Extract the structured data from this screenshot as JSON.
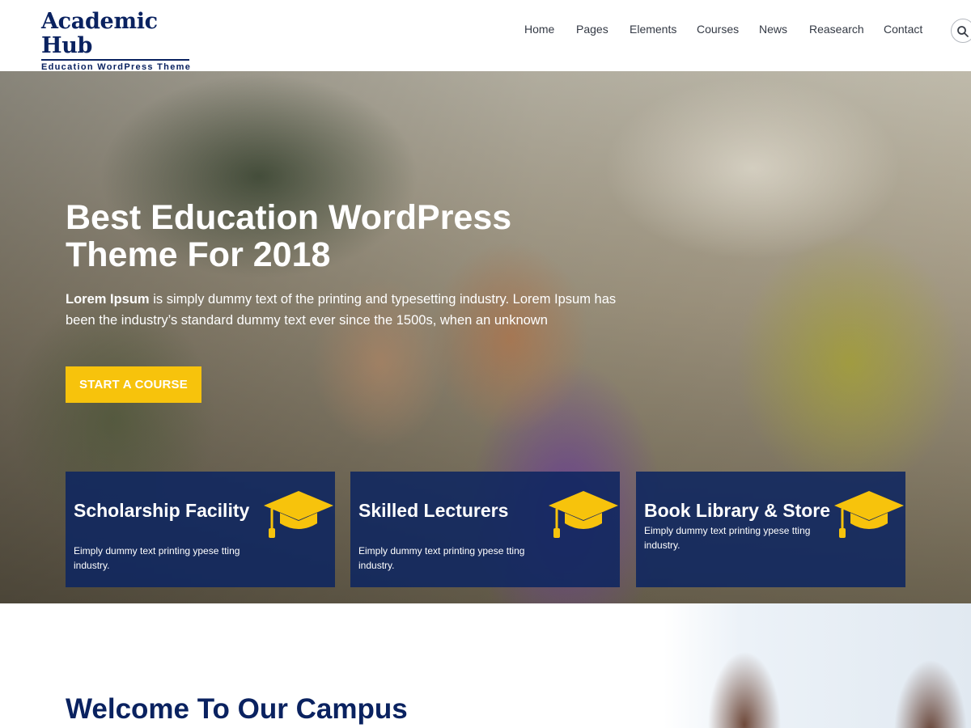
{
  "brand": {
    "title": "Academic Hub",
    "subtitle": "Education WordPress Theme",
    "color": "#0a2260"
  },
  "nav": {
    "items": [
      "Home",
      "Pages",
      "Elements",
      "Courses",
      "News",
      "Reasearch",
      "Contact"
    ]
  },
  "search": {
    "icon": "search-icon"
  },
  "hero": {
    "title": "Best Education WordPress Theme For 2018",
    "text_bold": "Lorem Ipsum",
    "text_rest": " is simply dummy text of the printing and typesetting industry. Lorem Ipsum has been the industry’s standard dummy text ever since the 1500s, when an unknown",
    "cta_label": "START A COURSE",
    "cta_color": "#f7c30c"
  },
  "features": [
    {
      "title": "Scholarship Facility",
      "text": "Eimply dummy text printing ypese tting industry.",
      "icon": "graduation-cap-icon"
    },
    {
      "title": "Skilled Lecturers",
      "text": "Eimply dummy text printing ypese tting industry.",
      "icon": "graduation-cap-icon"
    },
    {
      "title": "Book Library & Store",
      "text": "Eimply dummy text printing ypese tting industry.",
      "icon": "graduation-cap-icon"
    }
  ],
  "welcome": {
    "title": "Welcome To Our Campus"
  }
}
